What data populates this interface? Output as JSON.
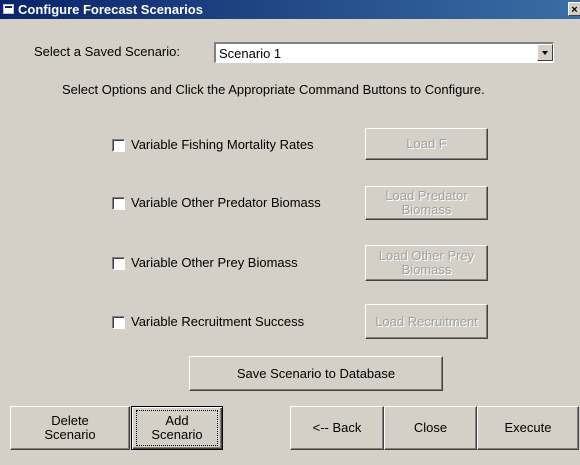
{
  "window": {
    "title": "Configure Forecast Scenarios",
    "close_glyph": "×"
  },
  "scenario": {
    "label": "Select a Saved Scenario:",
    "selected": "Scenario 1"
  },
  "instruction": "Select Options and Click the Appropriate Command Buttons to Configure.",
  "options": [
    {
      "label": "Variable Fishing Mortality Rates",
      "checked": false,
      "button": [
        "Load F"
      ]
    },
    {
      "label": "Variable Other Predator Biomass",
      "checked": false,
      "button": [
        "Load Predator",
        "Biomass"
      ]
    },
    {
      "label": "Variable Other Prey Biomass",
      "checked": false,
      "button": [
        "Load Other Prey",
        "Biomass"
      ]
    },
    {
      "label": "Variable Recruitment Success",
      "checked": false,
      "button": [
        "Load Recruitment"
      ]
    }
  ],
  "save_button": "Save Scenario to Database",
  "bottom": {
    "delete": [
      "Delete",
      "Scenario"
    ],
    "add": [
      "Add",
      "Scenario"
    ],
    "back": "<-- Back",
    "close": "Close",
    "execute": "Execute"
  }
}
